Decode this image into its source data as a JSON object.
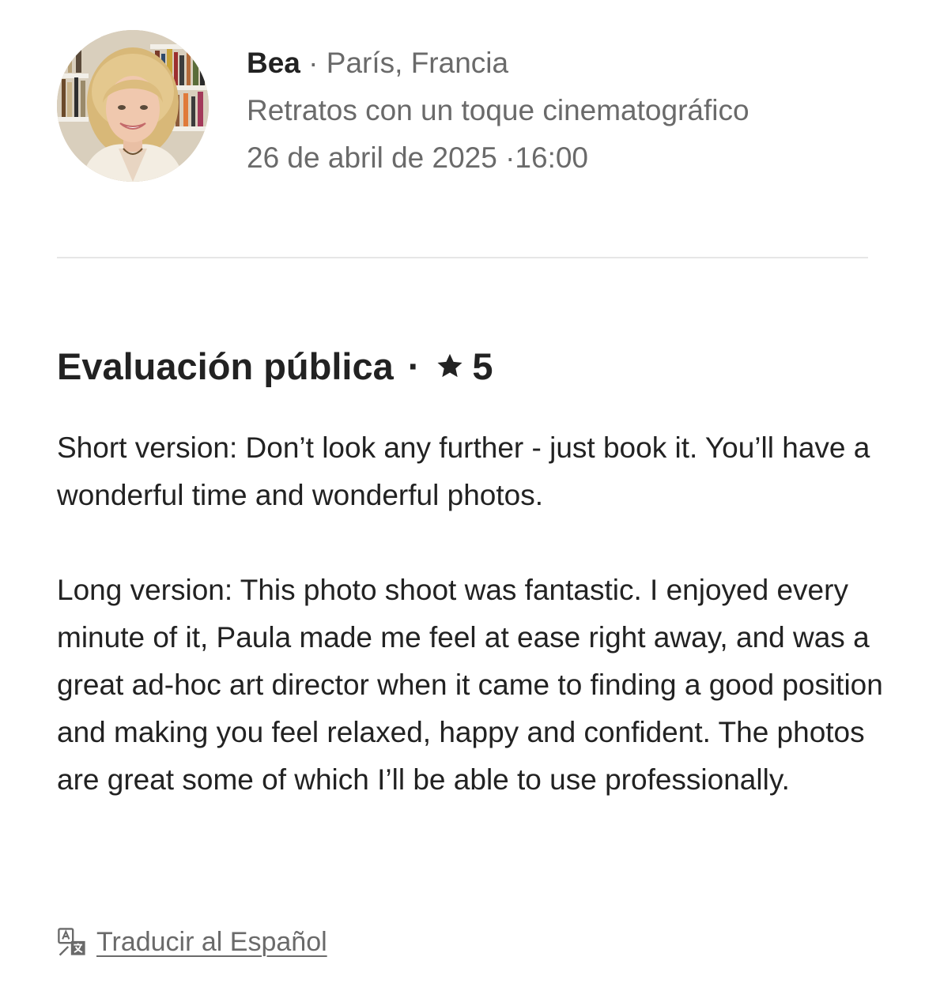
{
  "host": {
    "name": "Bea",
    "separator": "·",
    "location": "París, Francia",
    "experience_title": "Retratos con un toque cinematográfico",
    "date": "26 de abril de 2025",
    "time_separator": "·",
    "time": "16:00"
  },
  "review": {
    "heading": "Evaluación pública",
    "heading_separator": "·",
    "rating": "5",
    "paragraphs": [
      "Short version: Don’t look any further - just book it. You’ll have a wonderful time and wonderful photos.",
      "Long version: This photo shoot was fantastic. I enjoyed every minute of it, Paula made me feel at ease right away, and was a great ad-hoc art director when it came to finding a good position and making you feel relaxed, happy and confident. The photos are great some of which I’ll be able to use professionally."
    ]
  },
  "translate": {
    "label": "Traducir al Español",
    "icon": "translate-icon"
  },
  "colors": {
    "primary_text": "#222222",
    "secondary_text": "#6a6a6a",
    "divider": "#e6e6e6"
  }
}
